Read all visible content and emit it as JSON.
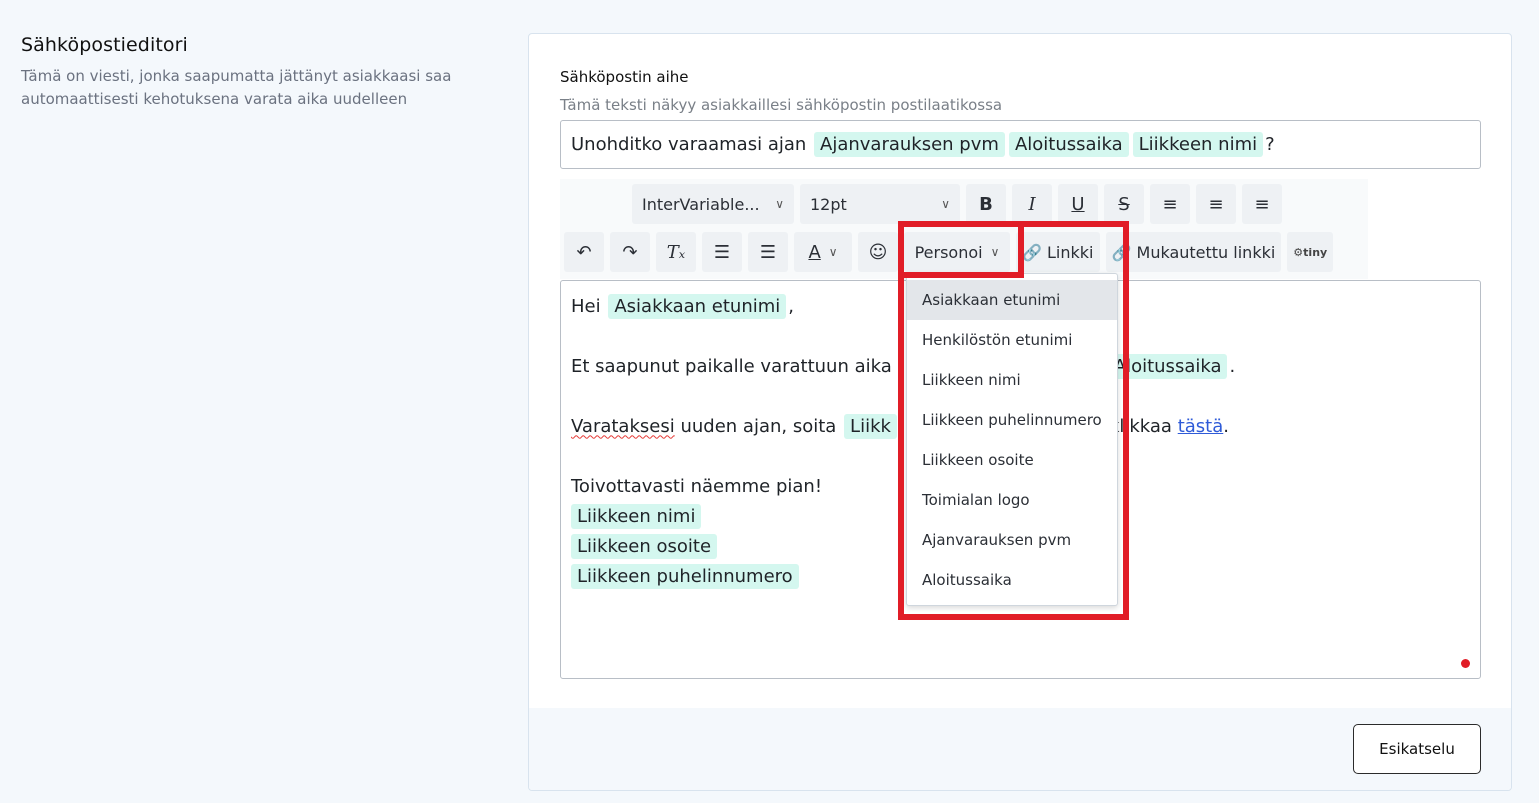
{
  "section": {
    "title": "Sähköpostieditori",
    "description_line1": "Tämä on viesti, jonka saapumatta jättänyt asiakkaasi saa",
    "description_line2": "automaattisesti kehotuksena varata aika uudelleen"
  },
  "subject": {
    "label": "Sähköpostin aihe",
    "help": "Tämä teksti näkyy asiakkaillesi sähköpostin postilaatikossa",
    "text_prefix": "Unohditko varaamasi ajan",
    "tag1": "Ajanvarauksen pvm",
    "tag2": "Aloitussaika",
    "tag3": "Liikkeen nimi",
    "text_suffix": "?"
  },
  "toolbar": {
    "font_family": "InterVariable...",
    "font_size": "12pt",
    "bold": "B",
    "italic": "I",
    "underline": "U",
    "strike": "S",
    "text_color": "A",
    "personalize": "Personoi",
    "link": "Linkki",
    "custom_link": "Mukautettu linkki",
    "tiny": "tiny"
  },
  "editor": {
    "greeting": "Hei",
    "greeting_tag": "Asiakkaan etunimi",
    "greeting_suffix": ",",
    "line2_prefix": "Et saapunut paikalle varattuun aika",
    "line2_tag": "Aloitussaika",
    "line2_suffix": ".",
    "line3_word": "Varataksesi",
    "line3_text": "uuden ajan, soita",
    "line3_tag_partial": "Liikk",
    "line3_after": "klikkaa",
    "line3_link": "tästä",
    "line3_end": ".",
    "closing": "Toivottavasti näemme pian!",
    "sig1": "Liikkeen nimi",
    "sig2": "Liikkeen osoite",
    "sig3": "Liikkeen puhelinnumero"
  },
  "dropdown": {
    "items": [
      "Asiakkaan etunimi",
      "Henkilöstön etunimi",
      "Liikkeen nimi",
      "Liikkeen puhelinnumero",
      "Liikkeen osoite",
      "Toimialan logo",
      "Ajanvarauksen pvm",
      "Aloitussaika"
    ]
  },
  "footer": {
    "preview_button": "Esikatselu"
  },
  "colors": {
    "tag_bg": "#d4f7ef",
    "highlight": "#e11d27",
    "link": "#2f5bd8"
  }
}
